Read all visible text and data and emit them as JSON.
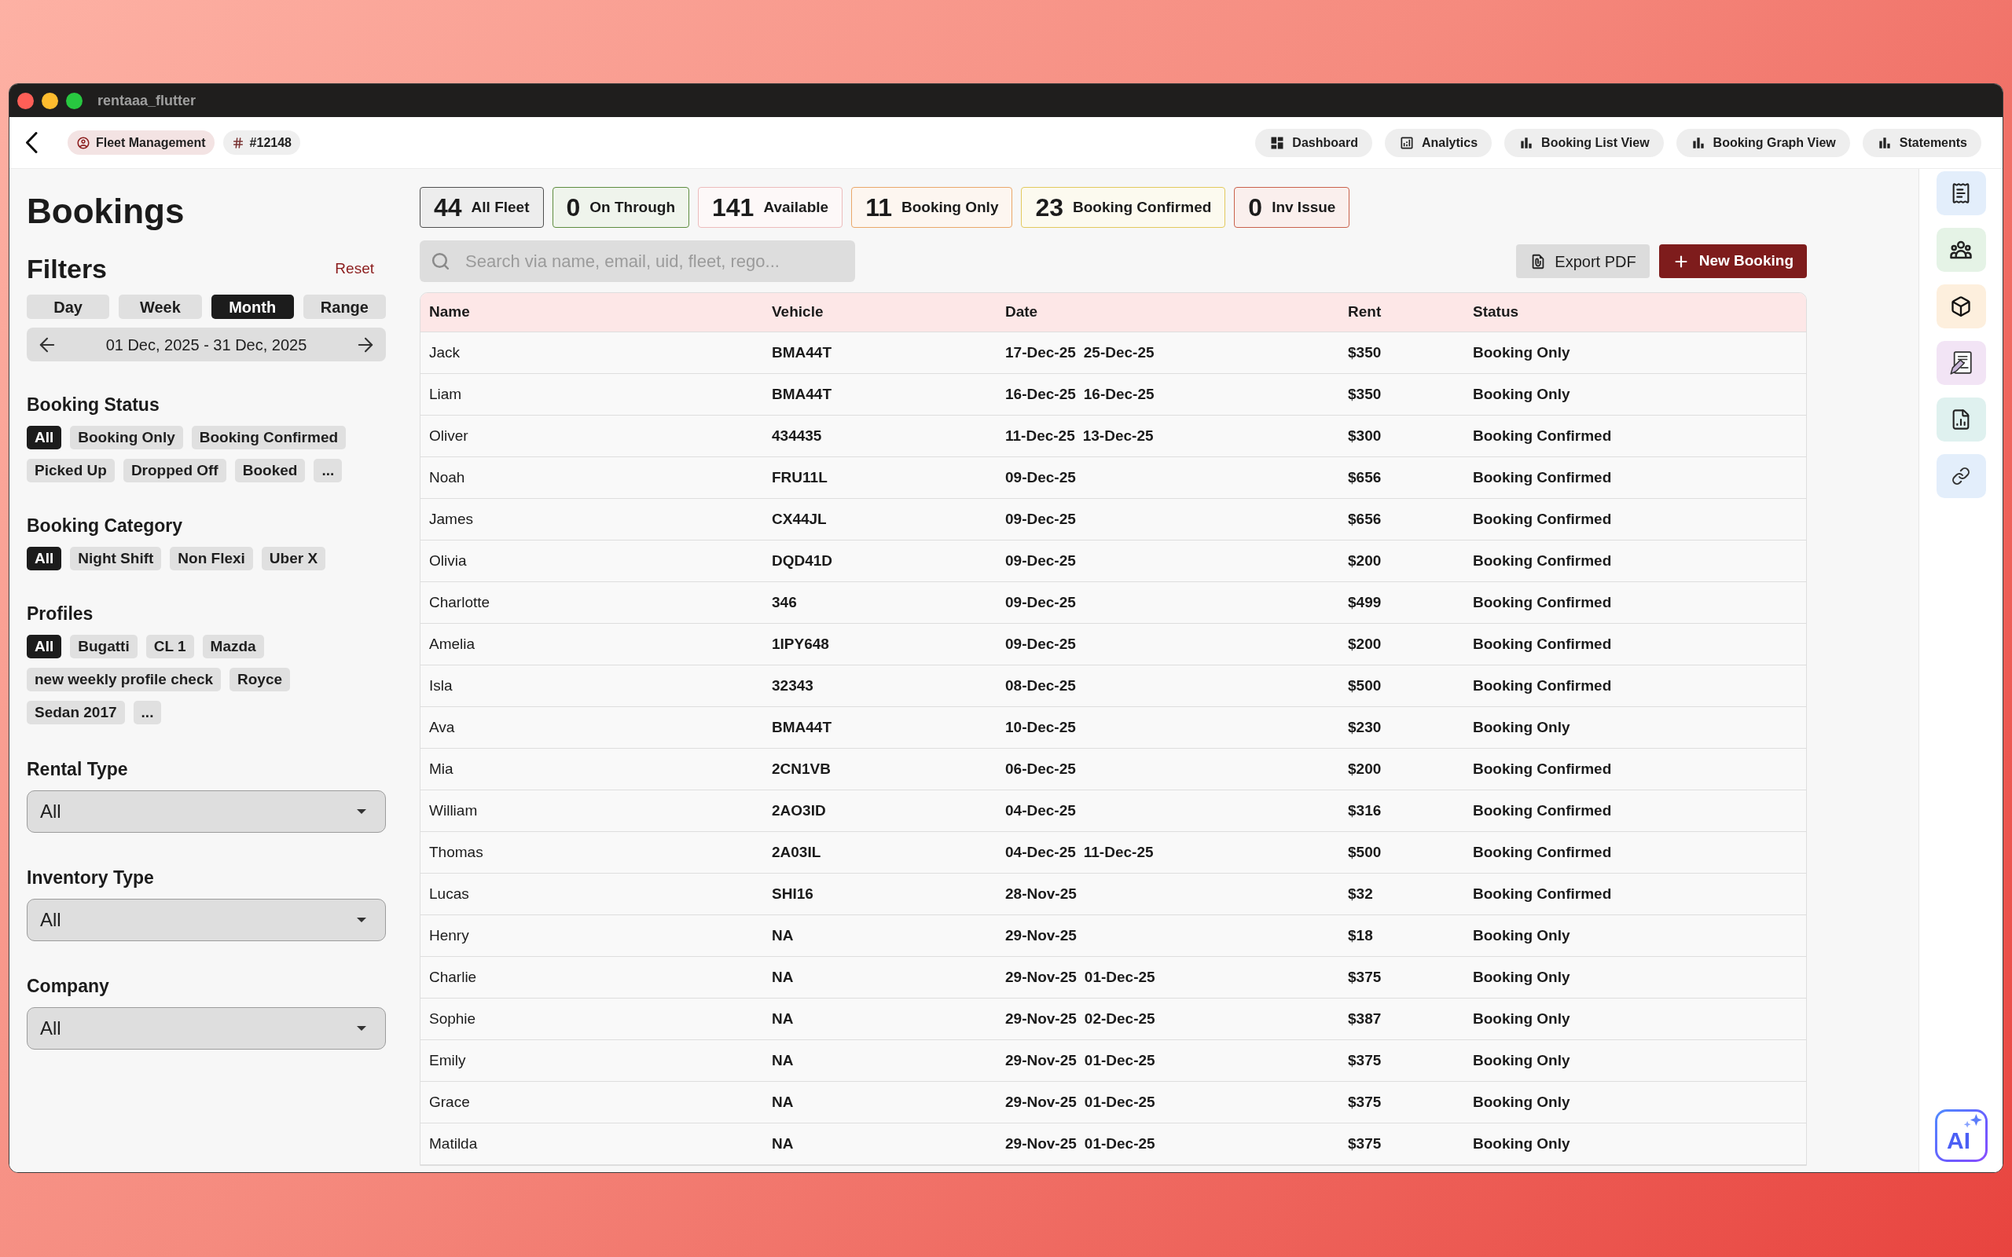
{
  "window": {
    "title": "rentaaa_flutter"
  },
  "nav": {
    "chips": [
      {
        "kind": "module",
        "label": "Fleet Management"
      },
      {
        "kind": "id",
        "label": "#12148"
      }
    ],
    "views": [
      {
        "kind": "dashboard",
        "label": "Dashboard"
      },
      {
        "kind": "analytics",
        "label": "Analytics"
      },
      {
        "kind": "bars",
        "label": "Booking List View"
      },
      {
        "kind": "bars",
        "label": "Booking Graph View"
      },
      {
        "kind": "bars",
        "label": "Statements"
      }
    ]
  },
  "sidebar": {
    "title": "Bookings",
    "filters_title": "Filters",
    "reset": "Reset",
    "periods": [
      {
        "label": "Day",
        "selected": false
      },
      {
        "label": "Week",
        "selected": false
      },
      {
        "label": "Month",
        "selected": true
      },
      {
        "label": "Range",
        "selected": false
      }
    ],
    "date_range": "01 Dec, 2025 - 31 Dec, 2025",
    "chip_groups": [
      {
        "title": "Booking Status",
        "chips": [
          {
            "label": "All",
            "selected": true
          },
          {
            "label": "Booking Only",
            "selected": false
          },
          {
            "label": "Booking Confirmed",
            "selected": false
          },
          {
            "label": "Picked Up",
            "selected": false
          },
          {
            "label": "Dropped Off",
            "selected": false
          },
          {
            "label": "Booked",
            "selected": false
          },
          {
            "label": "...",
            "selected": false
          }
        ]
      },
      {
        "title": "Booking Category",
        "chips": [
          {
            "label": "All",
            "selected": true
          },
          {
            "label": "Night Shift",
            "selected": false
          },
          {
            "label": "Non Flexi",
            "selected": false
          },
          {
            "label": "Uber X",
            "selected": false
          }
        ]
      },
      {
        "title": "Profiles",
        "chips": [
          {
            "label": "All",
            "selected": true
          },
          {
            "label": "Bugatti",
            "selected": false
          },
          {
            "label": "CL 1",
            "selected": false
          },
          {
            "label": "Mazda",
            "selected": false
          },
          {
            "label": "new weekly profile check",
            "selected": false
          },
          {
            "label": "Royce",
            "selected": false
          },
          {
            "label": "Sedan 2017",
            "selected": false
          },
          {
            "label": "...",
            "selected": false
          }
        ]
      }
    ],
    "dropdowns": [
      {
        "label": "Rental Type",
        "value": "All"
      },
      {
        "label": "Inventory Type",
        "value": "All"
      },
      {
        "label": "Company",
        "value": "All"
      }
    ]
  },
  "stats": [
    {
      "count": "44",
      "label": "All Fleet",
      "color": "#4f4f4f"
    },
    {
      "count": "0",
      "label": "On Through",
      "color": "#5e8d3f"
    },
    {
      "count": "141",
      "label": "Available",
      "color": "#ecbcbc"
    },
    {
      "count": "11",
      "label": "Booking Only",
      "color": "#eaa86a"
    },
    {
      "count": "23",
      "label": "Booking Confirmed",
      "color": "#e2c95e"
    },
    {
      "count": "0",
      "label": "Inv Issue",
      "color": "#c9624c"
    }
  ],
  "search": {
    "placeholder": "Search via name, email, uid, fleet, rego..."
  },
  "actions": [
    {
      "kind": "export",
      "label": "Export PDF"
    },
    {
      "kind": "create",
      "label": "New Booking"
    }
  ],
  "table": {
    "columns": [
      "Name",
      "Vehicle",
      "Date",
      "Rent",
      "Status"
    ],
    "rows": [
      {
        "name": "Jack",
        "vehicle": "BMA44T",
        "dates": [
          "17-Dec-25",
          "25-Dec-25"
        ],
        "rent": "$350",
        "status": "Booking Only"
      },
      {
        "name": "Liam",
        "vehicle": "BMA44T",
        "dates": [
          "16-Dec-25",
          "16-Dec-25"
        ],
        "rent": "$350",
        "status": "Booking Only"
      },
      {
        "name": "Oliver",
        "vehicle": "434435",
        "dates": [
          "11-Dec-25",
          "13-Dec-25"
        ],
        "rent": "$300",
        "status": "Booking Confirmed"
      },
      {
        "name": "Noah",
        "vehicle": "FRU11L",
        "dates": [
          "09-Dec-25"
        ],
        "rent": "$656",
        "status": "Booking Confirmed"
      },
      {
        "name": "James",
        "vehicle": "CX44JL",
        "dates": [
          "09-Dec-25"
        ],
        "rent": "$656",
        "status": "Booking Confirmed"
      },
      {
        "name": "Olivia",
        "vehicle": "DQD41D",
        "dates": [
          "09-Dec-25"
        ],
        "rent": "$200",
        "status": "Booking Confirmed"
      },
      {
        "name": "Charlotte",
        "vehicle": "346",
        "dates": [
          "09-Dec-25"
        ],
        "rent": "$499",
        "status": "Booking Confirmed"
      },
      {
        "name": "Amelia",
        "vehicle": "1IPY648",
        "dates": [
          "09-Dec-25"
        ],
        "rent": "$200",
        "status": "Booking Confirmed"
      },
      {
        "name": "Isla",
        "vehicle": "32343",
        "dates": [
          "08-Dec-25"
        ],
        "rent": "$500",
        "status": "Booking Confirmed"
      },
      {
        "name": "Ava",
        "vehicle": "BMA44T",
        "dates": [
          "10-Dec-25"
        ],
        "rent": "$230",
        "status": "Booking Only"
      },
      {
        "name": "Mia",
        "vehicle": "2CN1VB",
        "dates": [
          "06-Dec-25"
        ],
        "rent": "$200",
        "status": "Booking Confirmed"
      },
      {
        "name": "William",
        "vehicle": "2AO3ID",
        "dates": [
          "04-Dec-25"
        ],
        "rent": "$316",
        "status": "Booking Confirmed"
      },
      {
        "name": "Thomas",
        "vehicle": "2A03IL",
        "dates": [
          "04-Dec-25",
          "11-Dec-25"
        ],
        "rent": "$500",
        "status": "Booking Confirmed"
      },
      {
        "name": "Lucas",
        "vehicle": "SHI16",
        "dates": [
          "28-Nov-25"
        ],
        "rent": "$32",
        "status": "Booking Confirmed"
      },
      {
        "name": "Henry",
        "vehicle": "NA",
        "dates": [
          "29-Nov-25"
        ],
        "rent": "$18",
        "status": "Booking Only"
      },
      {
        "name": "Charlie",
        "vehicle": "NA",
        "dates": [
          "29-Nov-25",
          "01-Dec-25"
        ],
        "rent": "$375",
        "status": "Booking Only"
      },
      {
        "name": "Sophie",
        "vehicle": "NA",
        "dates": [
          "29-Nov-25",
          "02-Dec-25"
        ],
        "rent": "$387",
        "status": "Booking Only"
      },
      {
        "name": "Emily",
        "vehicle": "NA",
        "dates": [
          "29-Nov-25",
          "01-Dec-25"
        ],
        "rent": "$375",
        "status": "Booking Only"
      },
      {
        "name": "Grace",
        "vehicle": "NA",
        "dates": [
          "29-Nov-25",
          "01-Dec-25"
        ],
        "rent": "$375",
        "status": "Booking Only"
      },
      {
        "name": "Matilda",
        "vehicle": "NA",
        "dates": [
          "29-Nov-25",
          "01-Dec-25"
        ],
        "rent": "$375",
        "status": "Booking Only"
      }
    ]
  },
  "rail": [
    {
      "kind": "receipt",
      "color": "#e3eefb"
    },
    {
      "kind": "people",
      "color": "#e5f3e6"
    },
    {
      "kind": "box",
      "color": "#fdefdd"
    },
    {
      "kind": "contract",
      "color": "#f2e4f5"
    },
    {
      "kind": "report",
      "color": "#dff1ef"
    },
    {
      "kind": "link",
      "color": "#e3eefb"
    }
  ],
  "assistant": {
    "label": "AI"
  }
}
